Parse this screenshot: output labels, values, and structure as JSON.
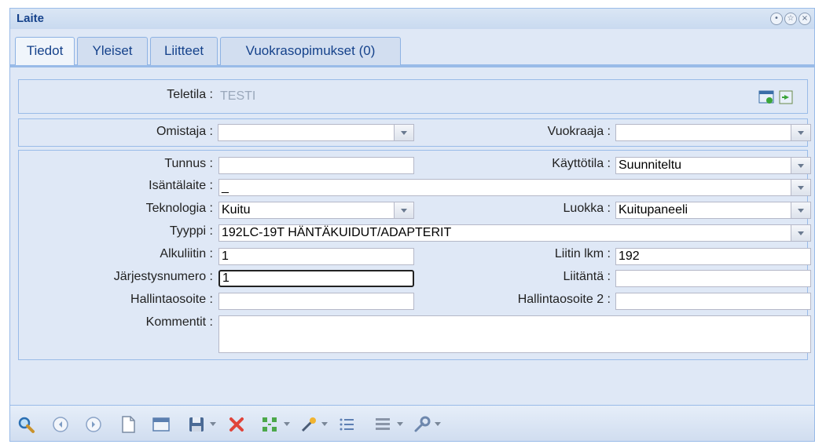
{
  "window": {
    "title": "Laite"
  },
  "tabs": [
    {
      "label": "Tiedot"
    },
    {
      "label": "Yleiset"
    },
    {
      "label": "Liitteet"
    },
    {
      "label": "Vuokrasopimukset (0)"
    }
  ],
  "teletila": {
    "label": "Teletila :",
    "value": "TESTI"
  },
  "omistaja": {
    "label": "Omistaja :",
    "value": ""
  },
  "vuokraaja": {
    "label": "Vuokraaja :",
    "value": ""
  },
  "tunnus": {
    "label": "Tunnus :",
    "value": ""
  },
  "kayttotila": {
    "label": "Käyttötila :",
    "value": "Suunniteltu"
  },
  "isantalaite": {
    "label": "Isäntälaite :",
    "value": "_"
  },
  "teknologia": {
    "label": "Teknologia :",
    "value": "Kuitu"
  },
  "luokka": {
    "label": "Luokka :",
    "value": "Kuitupaneeli"
  },
  "tyyppi": {
    "label": "Tyyppi :",
    "value": "192LC-19T HÄNTÄKUIDUT/ADAPTERIT"
  },
  "alkuliitin": {
    "label": "Alkuliitin :",
    "value": "1"
  },
  "liitin_lkm": {
    "label": "Liitin lkm :",
    "value": "192"
  },
  "jarjestysnumero": {
    "label": "Järjestysnumero :",
    "value": "1"
  },
  "liitanta": {
    "label": "Liitäntä :",
    "value": ""
  },
  "hallintaosoite": {
    "label": "Hallintaosoite :",
    "value": ""
  },
  "hallintaosoite2": {
    "label": "Hallintaosoite 2 :",
    "value": ""
  },
  "kommentit": {
    "label": "Kommentit :",
    "value": ""
  },
  "toolbar_icons": [
    "search-icon",
    "prev-icon",
    "next-icon",
    "new-document-icon",
    "window-icon",
    "save-icon",
    "delete-icon",
    "layout-icon",
    "wand-icon",
    "list-icon",
    "columns-icon",
    "wrench-icon"
  ]
}
